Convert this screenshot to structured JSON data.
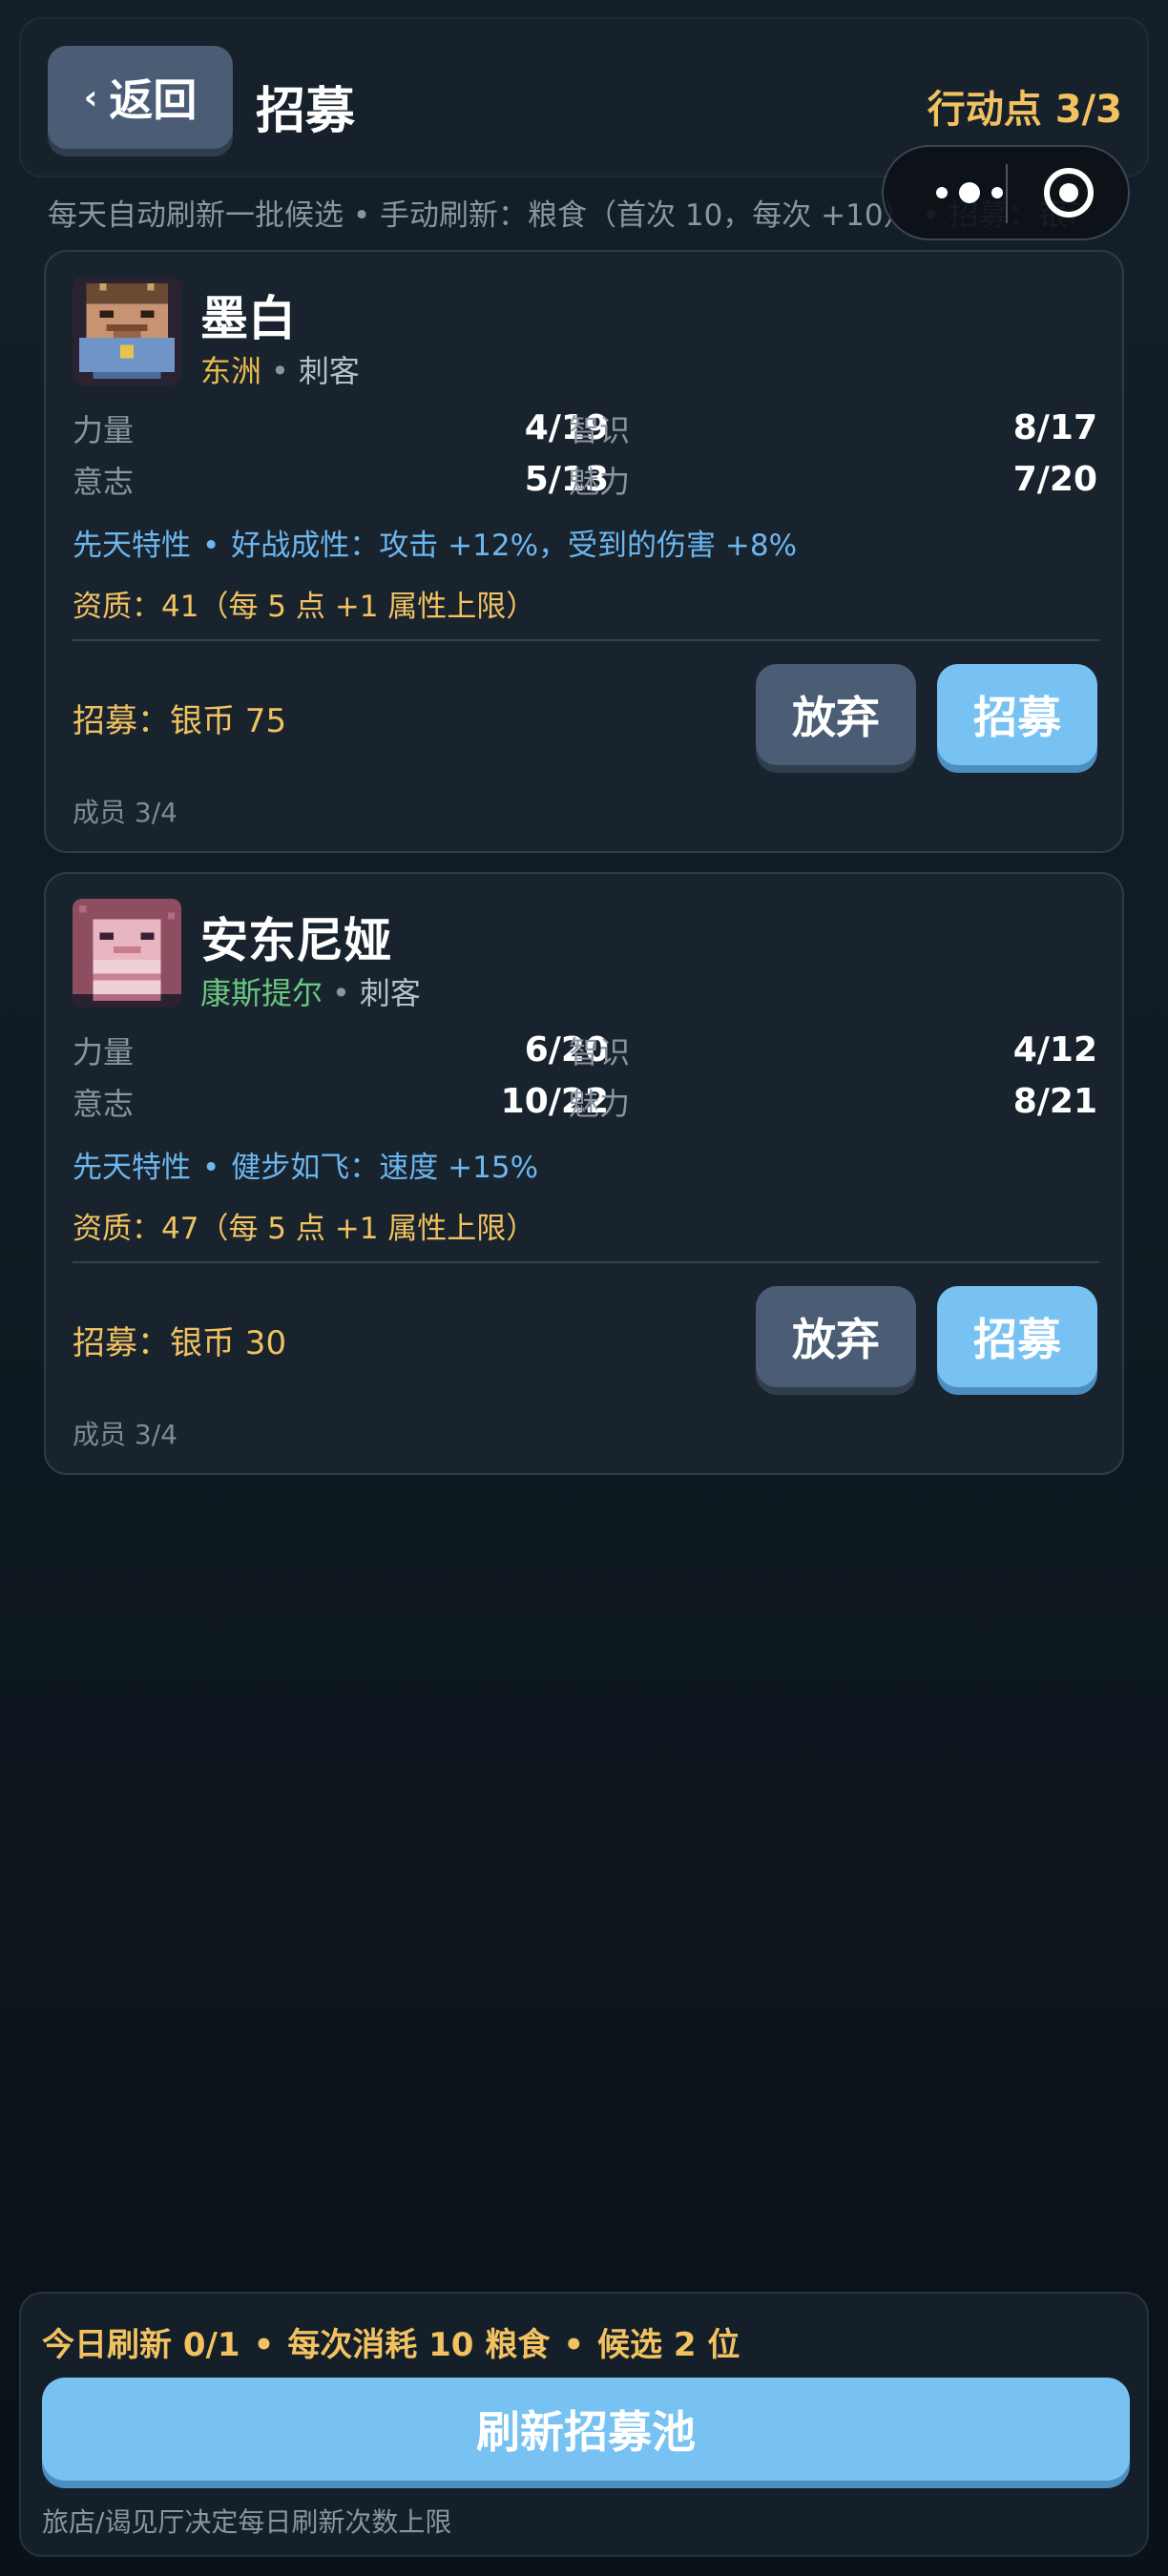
{
  "header": {
    "back_label": "返回",
    "back_chevron": "‹",
    "title": "招募",
    "action_points": "行动点 3/3"
  },
  "info_line": "每天自动刷新一批候选 • 手动刷新：粮食（首次 10，每次 +10） • 招募：银币",
  "capsule": {
    "icons": [
      "more-dots-icon",
      "close-circle-icon"
    ]
  },
  "candidates": [
    {
      "name": "墨白",
      "origin": "东洲",
      "origin_color": "#e8b94f",
      "class": "刺客",
      "stats": [
        {
          "label": "力量",
          "value": "4/19"
        },
        {
          "label": "智识",
          "value": "8/17"
        },
        {
          "label": "意志",
          "value": "5/13"
        },
        {
          "label": "魅力",
          "value": "7/20"
        }
      ],
      "trait_prefix": "先天特性",
      "trait": "好战成性：攻击 +12%，受到的伤害 +8%",
      "aptitude": "资质：41（每 5 点 +1 属性上限）",
      "cost": "招募：银币 75",
      "abandon_label": "放弃",
      "recruit_label": "招募",
      "members": "成员 3/4"
    },
    {
      "name": "安东尼娅",
      "origin": "康斯提尔",
      "origin_color": "#69c77f",
      "class": "刺客",
      "stats": [
        {
          "label": "力量",
          "value": "6/20"
        },
        {
          "label": "智识",
          "value": "4/12"
        },
        {
          "label": "意志",
          "value": "10/22"
        },
        {
          "label": "魅力",
          "value": "8/21"
        }
      ],
      "trait_prefix": "先天特性",
      "trait": "健步如飞：速度 +15%",
      "aptitude": "资质：47（每 5 点 +1 属性上限）",
      "cost": "招募：银币 30",
      "abandon_label": "放弃",
      "recruit_label": "招募",
      "members": "成员 3/4"
    }
  ],
  "bottom": {
    "refresh_count": "今日刷新 0/1",
    "refresh_cost": "每次消耗 10 粮食",
    "candidate_count": "候选 2 位",
    "refresh_button": "刷新招募池",
    "note": "旅店/谒见厅决定每日刷新次数上限"
  },
  "colors": {
    "accent_blue": "#77c2f2",
    "gold": "#f2c261",
    "trait_blue": "#6cb7ee",
    "button_gray": "#4a5d75"
  }
}
